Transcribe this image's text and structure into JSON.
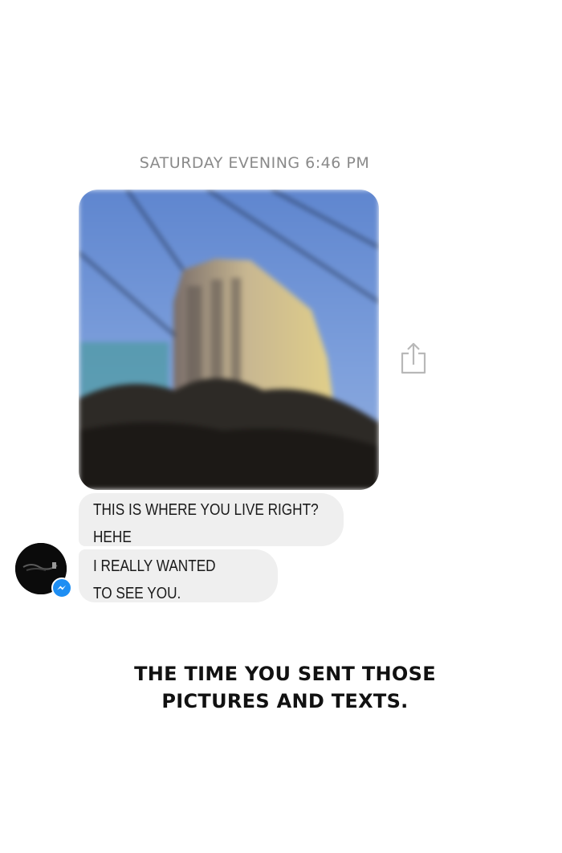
{
  "conversation": {
    "timestamp": "SATURDAY EVENING 6:46 PM",
    "photo_icon": "shared-photo-of-apartment-building",
    "share_icon": "share-icon",
    "messages": [
      {
        "lines": [
          "THIS IS WHERE YOU LIVE RIGHT?",
          "HEHE"
        ]
      },
      {
        "lines": [
          "I REALLY WANTED",
          "TO SEE YOU."
        ]
      }
    ],
    "avatar_icon": "avatar",
    "badge_icon": "messenger-icon",
    "colors": {
      "bubble": "#efefef",
      "timestamp": "#8a8a8a",
      "badge": "#1e8ef3"
    }
  },
  "caption": {
    "line1": "THE TIME YOU SENT THOSE",
    "line2": "PICTURES AND TEXTS."
  }
}
